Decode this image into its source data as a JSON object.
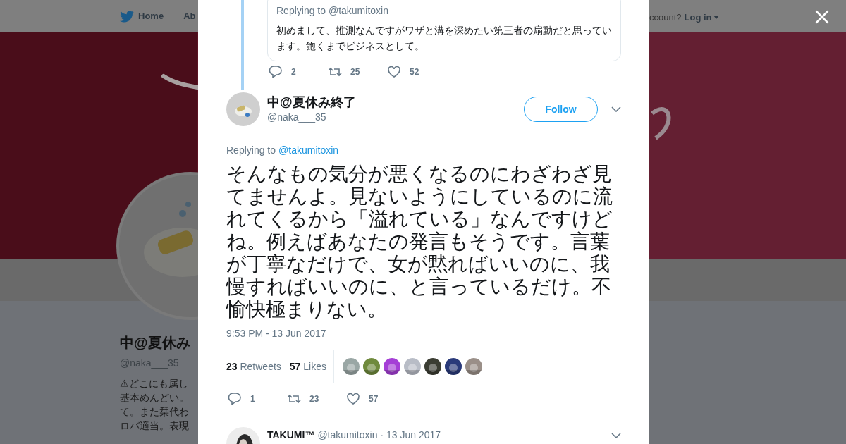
{
  "background": {
    "nav": [
      {
        "label": "Home"
      },
      {
        "label": "Ab"
      }
    ],
    "login_prompt": "ccount?",
    "login": "Log in",
    "profile": {
      "name": "中@夏休み",
      "handle": "@naka___35",
      "bio_lines": [
        "⚠どこにも属し",
        "基本めんどい。",
        "て。また栞代わ",
        "ロバ適当。表現"
      ]
    }
  },
  "previous_reply": {
    "replying_to": "Replying to @takumitoxin",
    "text": "初めまして、推測なんですがワザと溝を深めたい第三者の扇動だと思っています。飽くまでビジネスとして。",
    "replies": "2",
    "retweets": "25",
    "likes": "52"
  },
  "tweet": {
    "name": "中@夏休み終了",
    "handle": "@naka___35",
    "follow": "Follow",
    "replying_label": "Replying to",
    "replying_link": "@takumitoxin",
    "text": "そんなもの気分が悪くなるのにわざわざ見てませんよ。見ないようにしているのに流れてくるから「溢れている」なんですけどね。例えばあなたの発言もそうです。言葉が丁寧なだけで、女が黙ればいいのに、我慢すればいいのに、と言っているだけ。不愉快極まりない。",
    "time": "9:53 PM - 13 Jun 2017",
    "retweet_count": "23",
    "retweet_label": "Retweets",
    "like_count": "57",
    "like_label": "Likes",
    "likers": [
      {
        "color": "#9aa7a5"
      },
      {
        "color": "#6f8a3c"
      },
      {
        "color": "#a53fd6"
      },
      {
        "color": "#b8bcc6"
      },
      {
        "color": "#3b3d33"
      },
      {
        "color": "#2a3a7a"
      },
      {
        "color": "#9a8f88"
      }
    ],
    "replies": "1",
    "retweets": "23",
    "likes": "57"
  },
  "next_tweet": {
    "name": "TAKUMI™",
    "handle": "@takumitoxin",
    "date": "· 13 Jun 2017"
  }
}
